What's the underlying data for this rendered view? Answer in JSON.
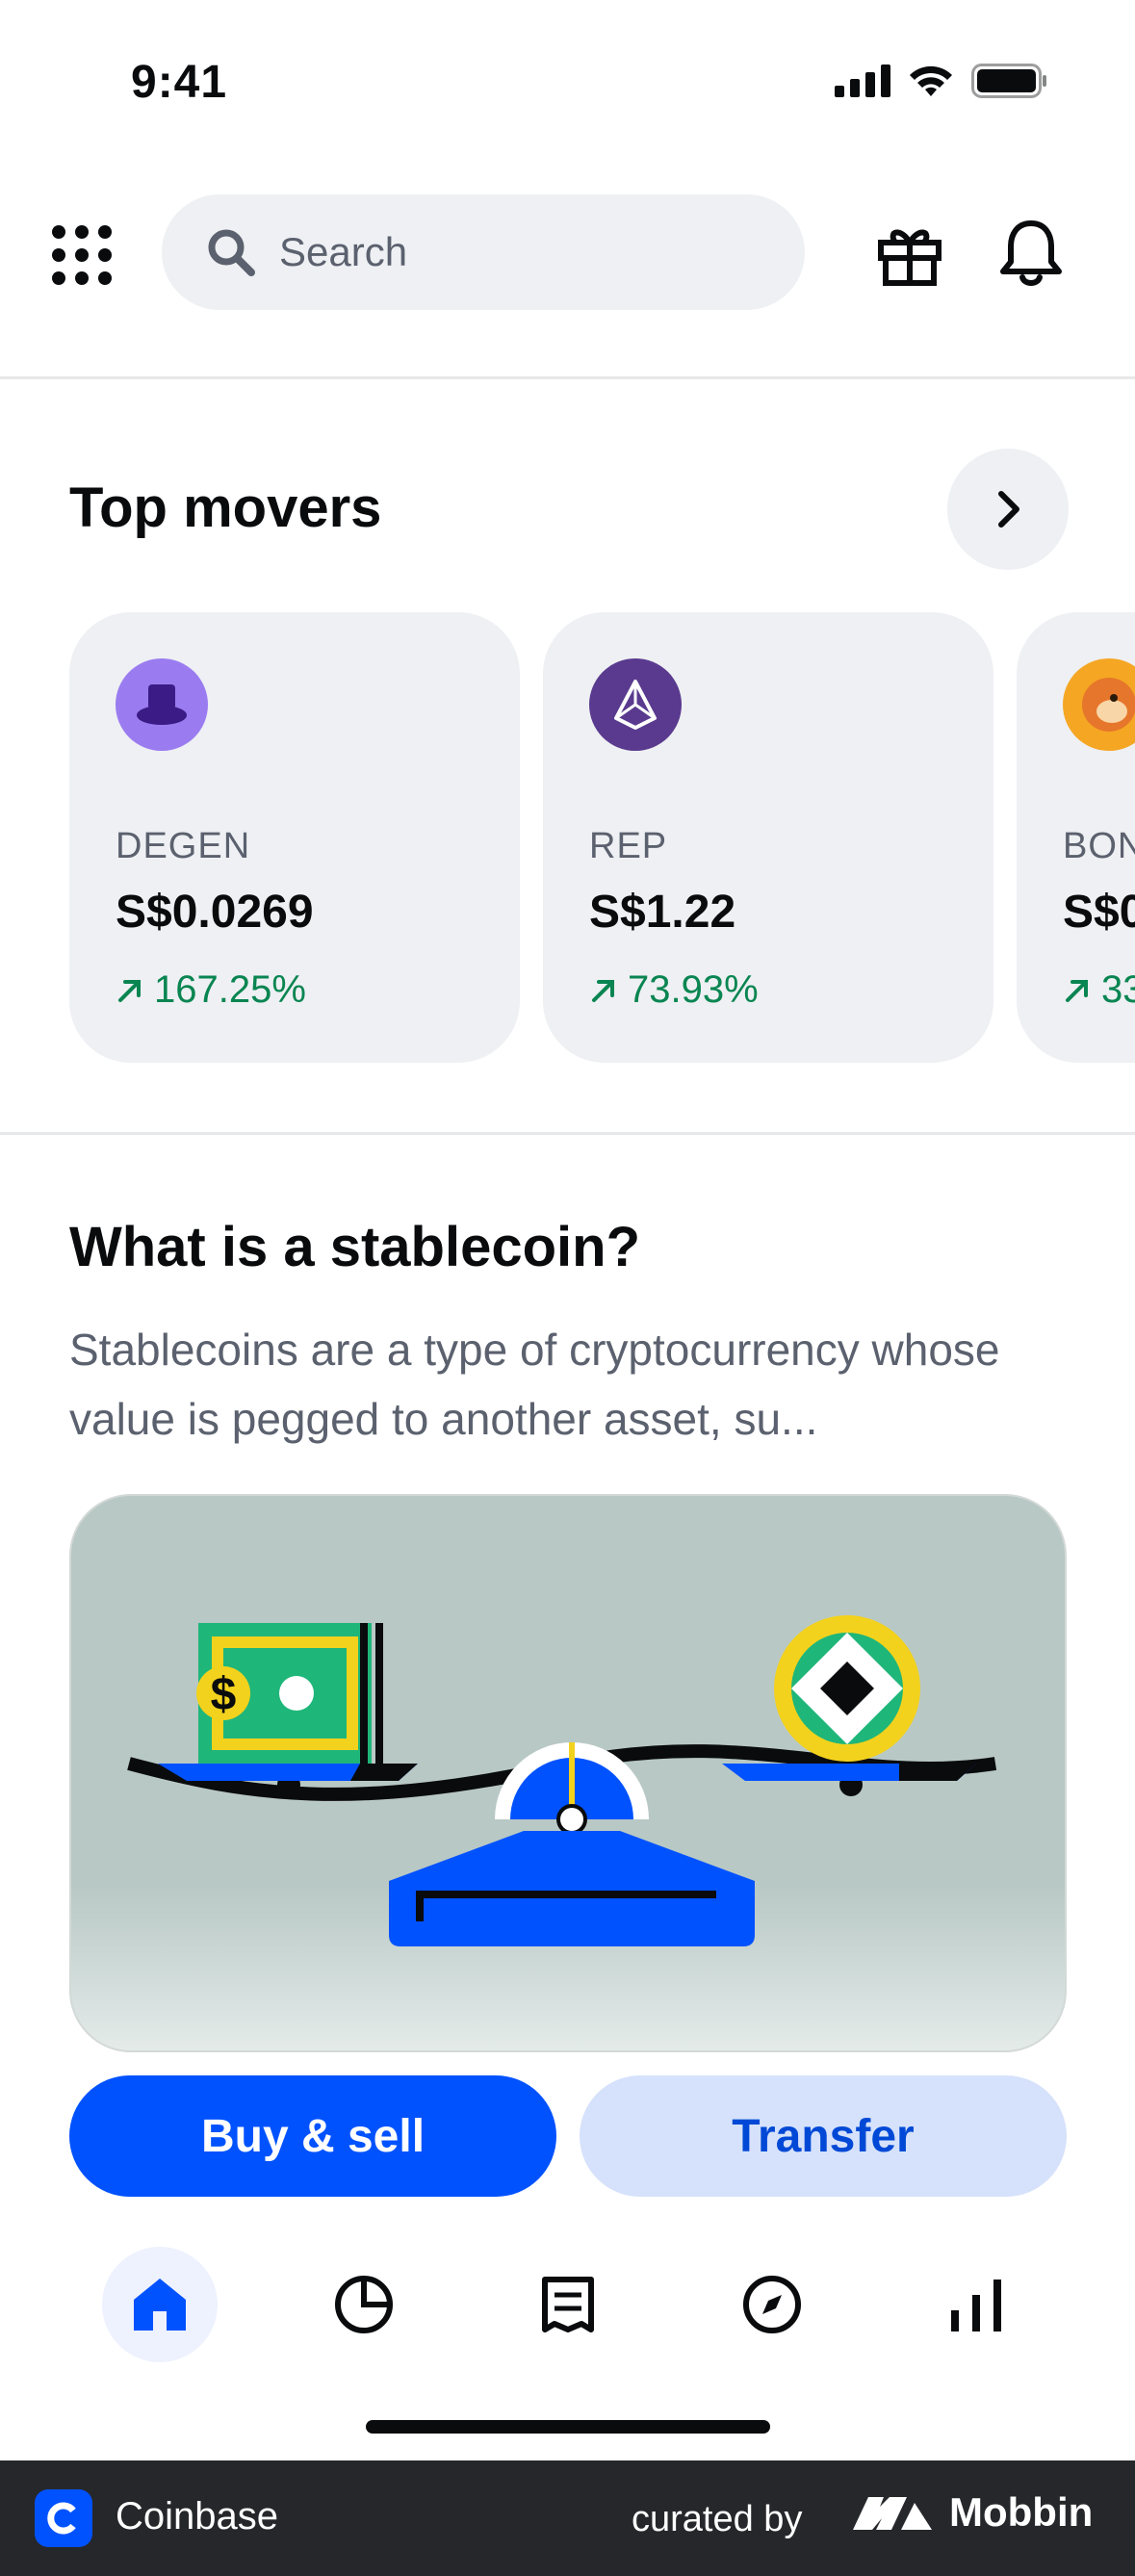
{
  "status_bar": {
    "time": "9:41"
  },
  "header": {
    "search_placeholder": "Search",
    "icons": [
      "apps-grid-icon",
      "search-icon",
      "gift-icon",
      "bell-icon"
    ]
  },
  "top_movers": {
    "title": "Top movers",
    "items": [
      {
        "symbol": "DEGEN",
        "price": "S$0.0269",
        "change": "167.25%",
        "logo_color": "#9b7cf0"
      },
      {
        "symbol": "REP",
        "price": "S$1.22",
        "change": "73.93%",
        "logo_color": "#5a3a8f"
      },
      {
        "symbol": "BON",
        "price": "S$0",
        "change": "33",
        "logo_color": "#f5a623"
      }
    ]
  },
  "stablecoin": {
    "title": "What is a stablecoin?",
    "description": "Stablecoins are a type of cryptocurrency whose value is pegged to another asset, su..."
  },
  "actions": {
    "buy_sell": "Buy & sell",
    "transfer": "Transfer"
  },
  "bottom_nav": {
    "items": [
      "home-icon",
      "portfolio-icon",
      "transactions-icon",
      "explore-icon",
      "markets-icon"
    ],
    "active": "home-icon"
  },
  "footer": {
    "app_name": "Coinbase",
    "curated_by": "curated by",
    "brand": "Mobbin"
  },
  "colors": {
    "accent": "#0052ff",
    "positive": "#098551",
    "surface": "#eef0f3"
  }
}
